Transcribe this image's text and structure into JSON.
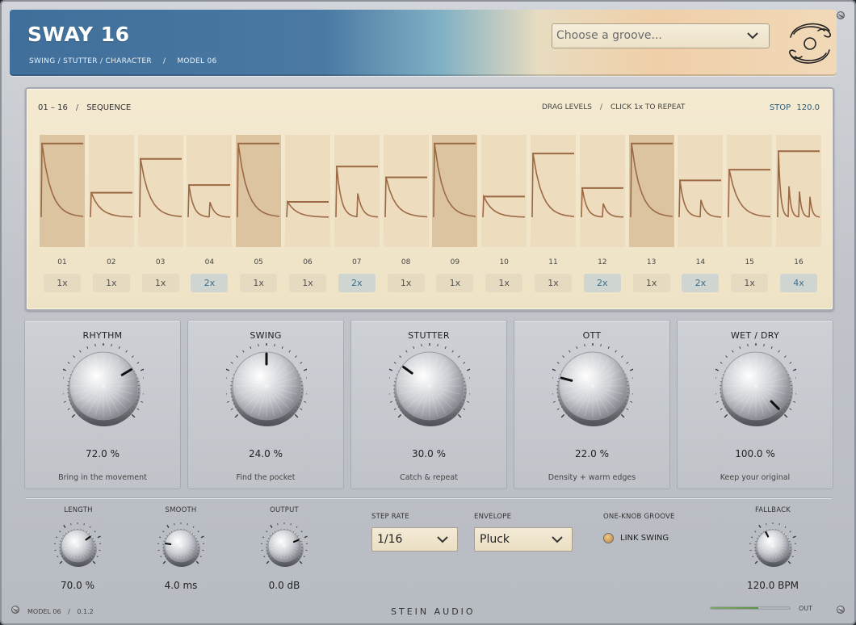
{
  "header": {
    "title": "SWAY 16",
    "subtitle_parts": [
      "SWING / STUTTER / CHARACTER",
      "/",
      "MODEL 06"
    ],
    "groove_placeholder": "Choose a groove..."
  },
  "sequence": {
    "range": "01 – 16",
    "label": "SEQUENCE",
    "hint_drag": "DRAG LEVELS",
    "hint_click": "CLICK 1x TO REPEAT",
    "status": "STOP",
    "bpm": "120.0",
    "steps": [
      {
        "num": "01",
        "repeat": "1x",
        "level": 0.96,
        "highlight": true
      },
      {
        "num": "02",
        "repeat": "1x",
        "level": 0.32,
        "highlight": false
      },
      {
        "num": "03",
        "repeat": "1x",
        "level": 0.76,
        "highlight": false
      },
      {
        "num": "04",
        "repeat": "2x",
        "level": 0.42,
        "highlight": false
      },
      {
        "num": "05",
        "repeat": "1x",
        "level": 0.96,
        "highlight": true
      },
      {
        "num": "06",
        "repeat": "1x",
        "level": 0.2,
        "highlight": false
      },
      {
        "num": "07",
        "repeat": "2x",
        "level": 0.66,
        "highlight": false
      },
      {
        "num": "08",
        "repeat": "1x",
        "level": 0.52,
        "highlight": false
      },
      {
        "num": "09",
        "repeat": "1x",
        "level": 0.96,
        "highlight": true
      },
      {
        "num": "10",
        "repeat": "1x",
        "level": 0.27,
        "highlight": false
      },
      {
        "num": "11",
        "repeat": "1x",
        "level": 0.83,
        "highlight": false
      },
      {
        "num": "12",
        "repeat": "2x",
        "level": 0.38,
        "highlight": false
      },
      {
        "num": "13",
        "repeat": "1x",
        "level": 0.96,
        "highlight": true
      },
      {
        "num": "14",
        "repeat": "2x",
        "level": 0.48,
        "highlight": false
      },
      {
        "num": "15",
        "repeat": "1x",
        "level": 0.62,
        "highlight": false
      },
      {
        "num": "16",
        "repeat": "4x",
        "level": 0.86,
        "highlight": false
      }
    ]
  },
  "modules": [
    {
      "title": "RHYTHM",
      "value": "72.0 %",
      "desc": "Bring in the movement",
      "amount": 0.72
    },
    {
      "title": "SWING",
      "value": "24.0 %",
      "desc": "Find the pocket",
      "amount": 0.5
    },
    {
      "title": "STUTTER",
      "value": "30.0 %",
      "desc": "Catch & repeat",
      "amount": 0.3
    },
    {
      "title": "OTT",
      "value": "22.0 %",
      "desc": "Density + warm edges",
      "amount": 0.22
    },
    {
      "title": "WET / DRY",
      "value": "100.0 %",
      "desc": "Keep your original",
      "amount": 1.0
    }
  ],
  "bottom": {
    "length": {
      "label": "LENGTH",
      "value": "70.0 %",
      "amount": 0.7
    },
    "smooth": {
      "label": "SMOOTH",
      "value": "4.0 ms",
      "amount": 0.2
    },
    "output": {
      "label": "OUTPUT",
      "value": "0.0 dB",
      "amount": 0.75
    },
    "step_rate": {
      "label": "STEP RATE",
      "value": "1/16"
    },
    "envelope": {
      "label": "ENVELOPE",
      "value": "Pluck"
    },
    "one_knob": {
      "label": "ONE-KNOB GROOVE",
      "toggle_label": "LINK SWING"
    },
    "fallback": {
      "label": "FALLBACK",
      "value": "120.0 BPM",
      "amount": 0.4
    }
  },
  "footer": {
    "model": "MODEL 06",
    "version": "0.1.2",
    "brand": "STEIN AUDIO",
    "out_label": "OUT",
    "out_level": 0.6
  },
  "colors": {
    "accent_blue": "#3e6d8a",
    "envelope_line": "#9b6a45",
    "sequence_bg": "#f1e5c9"
  }
}
